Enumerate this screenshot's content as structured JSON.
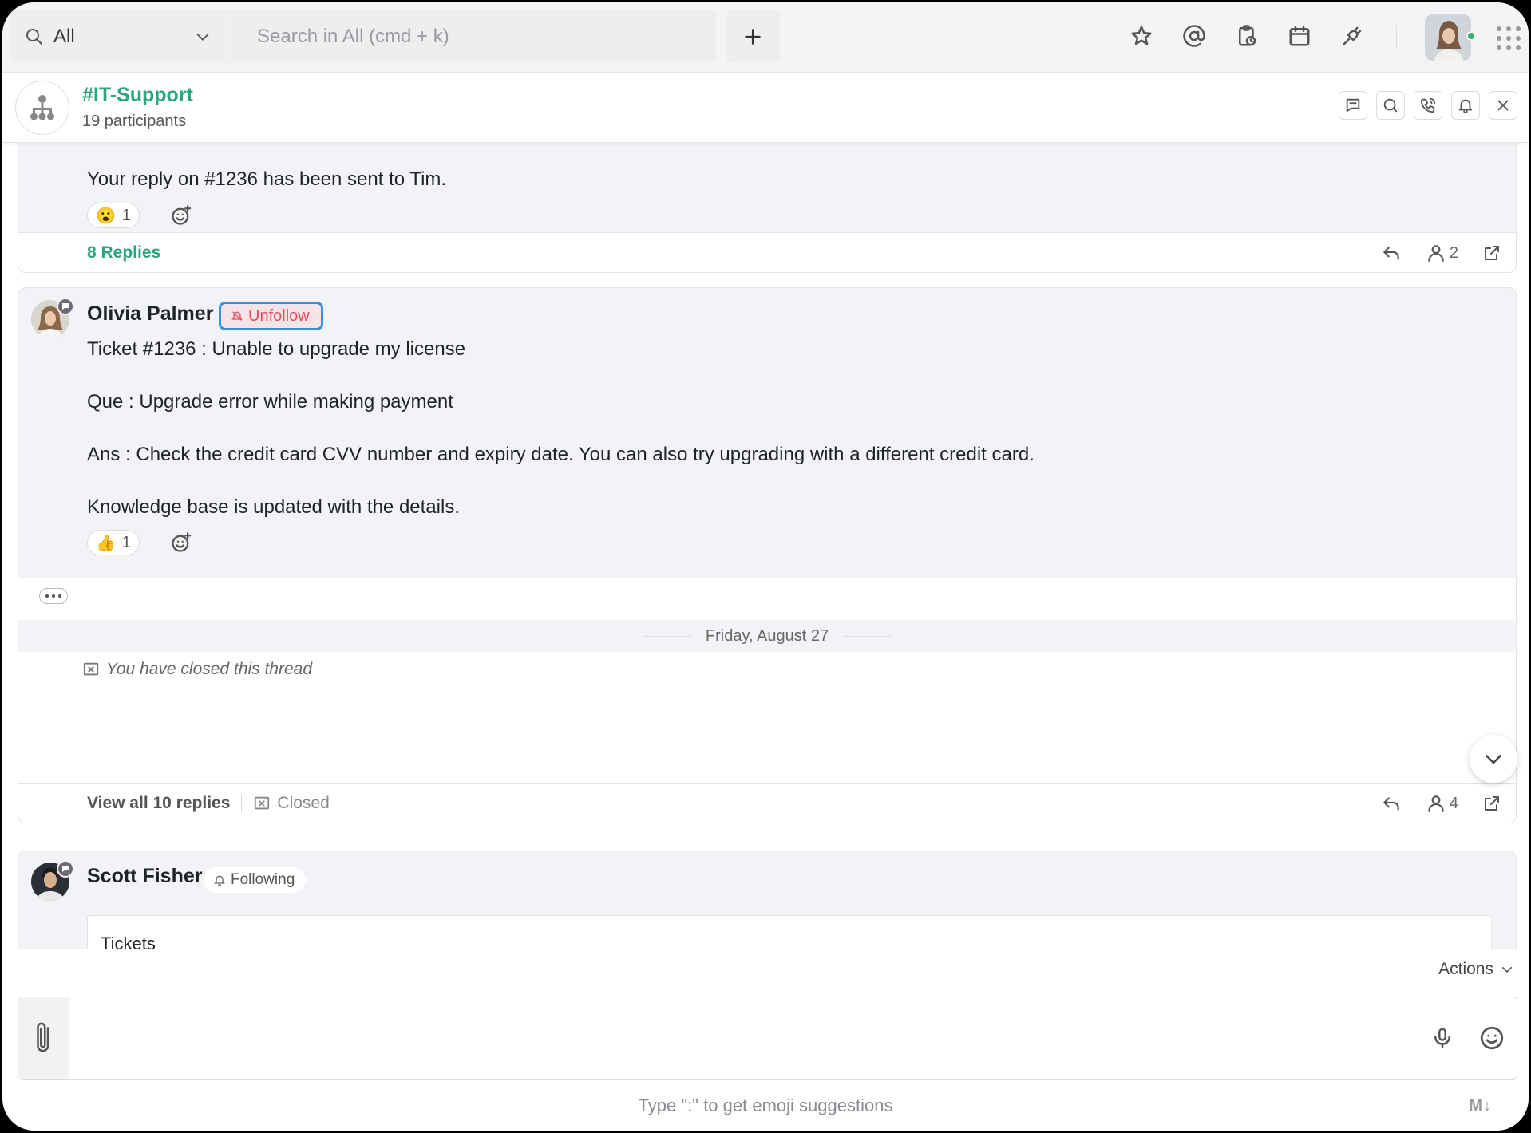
{
  "topbar": {
    "scope_label": "All",
    "search_placeholder": "Search in All (cmd + k)"
  },
  "channel": {
    "name": "#IT-Support",
    "participants": "19 participants"
  },
  "thread1": {
    "text": "Your reply on #1236 has been sent to Tim.",
    "reaction_emoji": "😮",
    "reaction_count": "1",
    "replies_label": "8 Replies",
    "participant_count": "2"
  },
  "thread2": {
    "author": "Olivia Palmer",
    "follow_label": "Unfollow",
    "lines": [
      "Ticket #1236 : Unable to upgrade my license",
      "Que : Upgrade error while making payment",
      "Ans : Check the credit card CVV number and expiry date. You can also try upgrading with a different credit card.",
      "Knowledge base is updated with the details."
    ],
    "reaction_emoji": "👍",
    "reaction_count": "1",
    "date_divider": "Friday, August 27",
    "closed_note": "You have closed this thread",
    "view_replies": "View all 10 replies",
    "status": "Closed",
    "participant_count": "4"
  },
  "thread3": {
    "author": "Scott Fisher",
    "follow_label": "Following",
    "preview_text": "Tickets"
  },
  "composer": {
    "actions_label": "Actions",
    "hint": "Type \":\" to get emoji suggestions",
    "markdown_badge": "M↓"
  },
  "colors": {
    "accent": "#2aa67e",
    "unfollow_text": "#e14d5b",
    "focus_ring": "#3b8fe0",
    "online": "#30b369"
  }
}
